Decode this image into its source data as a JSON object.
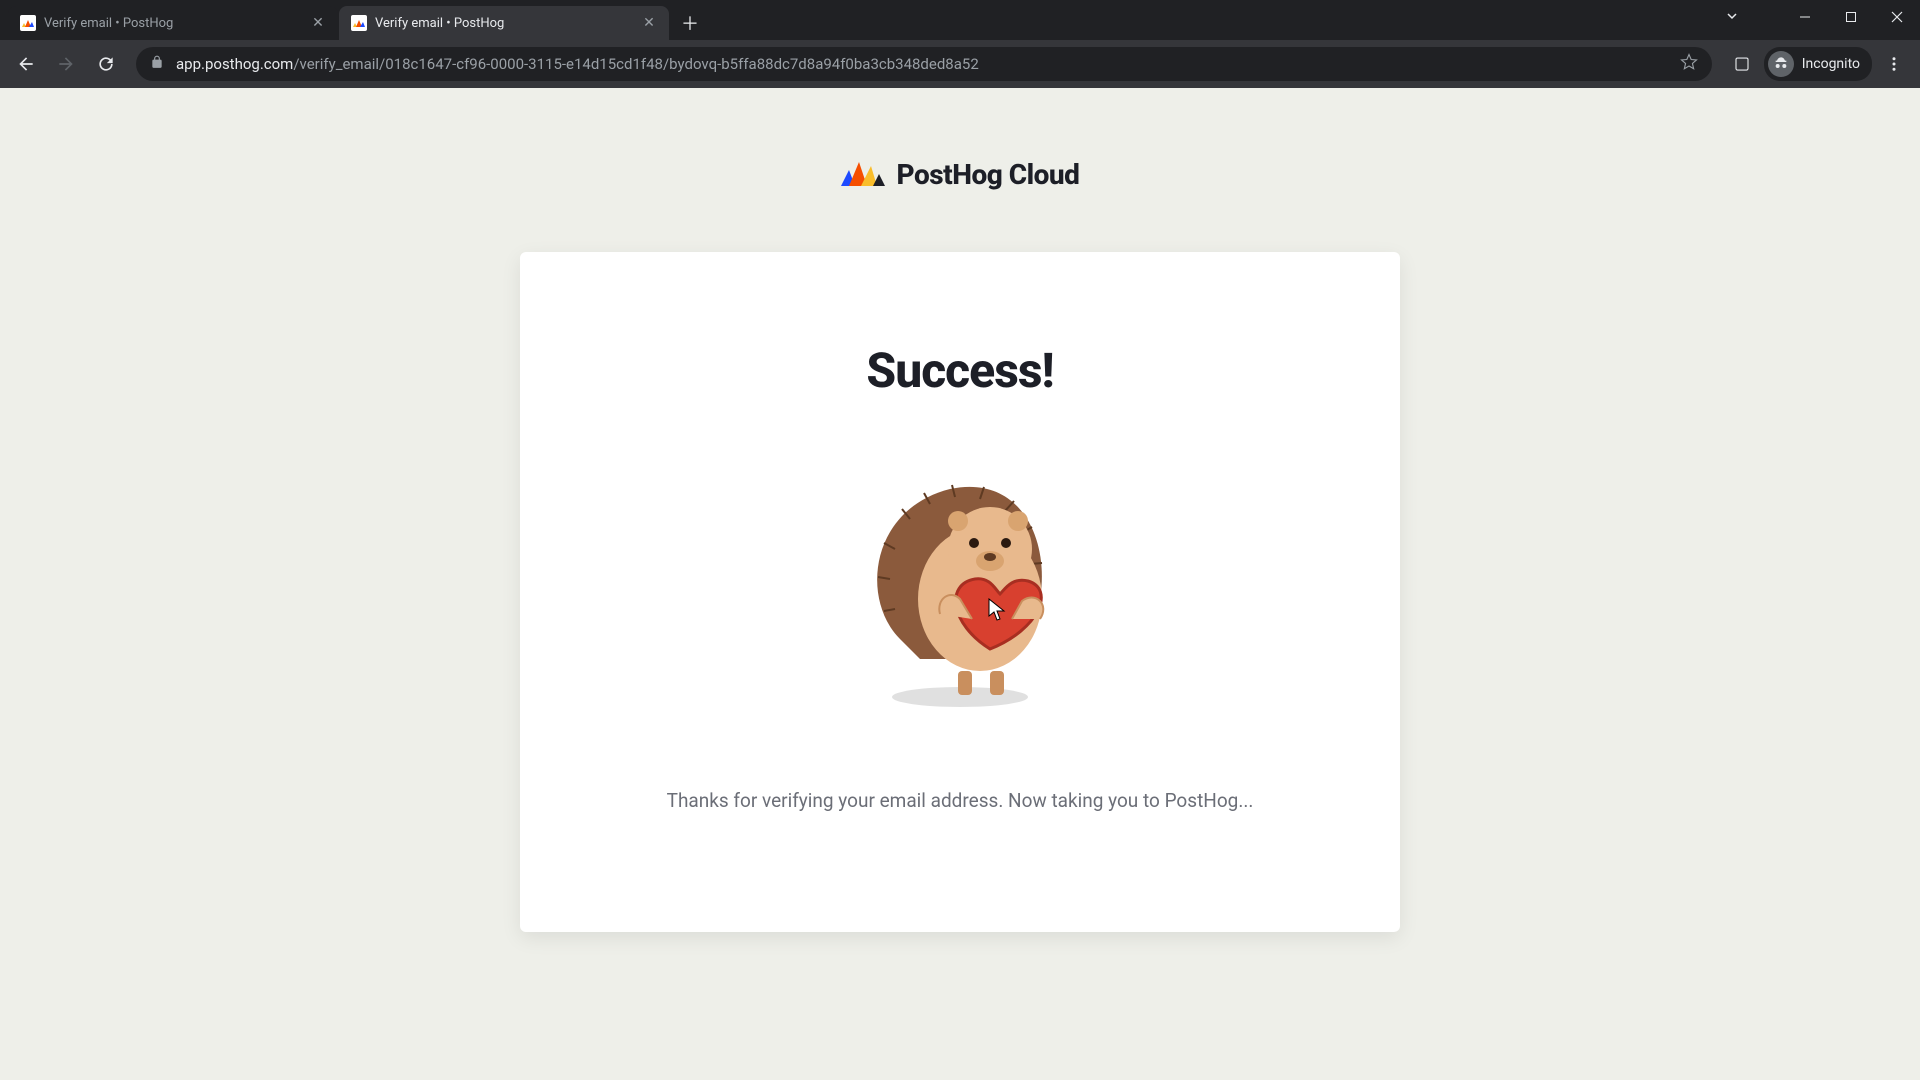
{
  "browser": {
    "tabs": [
      {
        "title": "Verify email • PostHog",
        "active": false
      },
      {
        "title": "Verify email • PostHog",
        "active": true
      }
    ],
    "url_domain": "app.posthog.com",
    "url_path": "/verify_email/018c1647-cf96-0000-3115-e14d15cd1f48/bydovq-b5ffa88dc7d8a94f0ba3cb348ded8a52",
    "incognito_label": "Incognito"
  },
  "page": {
    "brand": "PostHog Cloud",
    "heading": "Success!",
    "message": "Thanks for verifying your email address. Now taking you to PostHog..."
  }
}
